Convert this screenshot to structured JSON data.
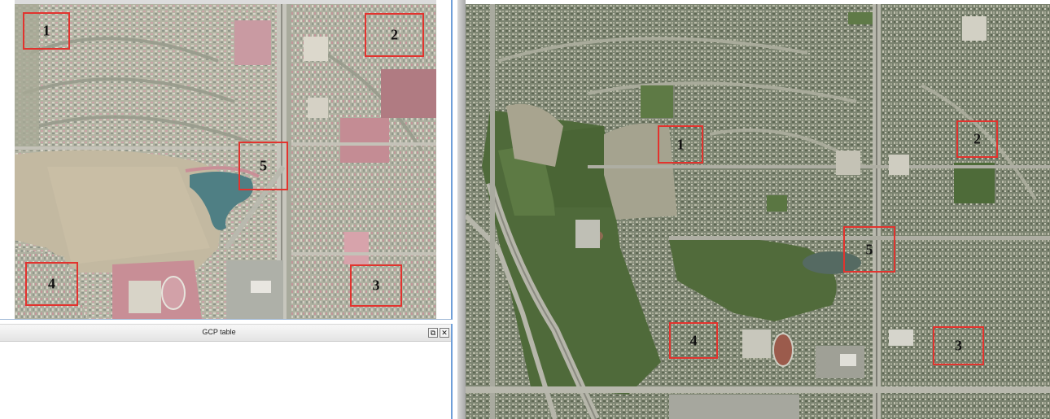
{
  "gcp_dock": {
    "title": "GCP table",
    "float_icon": "restore-window-icon",
    "close_icon": "close-icon"
  },
  "left_map": {
    "gcp_points": [
      {
        "label": "1"
      },
      {
        "label": "2"
      },
      {
        "label": "3"
      },
      {
        "label": "4"
      },
      {
        "label": "5"
      }
    ]
  },
  "right_map": {
    "gcp_points": [
      {
        "label": "1"
      },
      {
        "label": "2"
      },
      {
        "label": "3"
      },
      {
        "label": "4"
      },
      {
        "label": "5"
      }
    ]
  },
  "colors": {
    "gcp_marker": "#e2332e",
    "dock_border": "#6f9fd8"
  }
}
